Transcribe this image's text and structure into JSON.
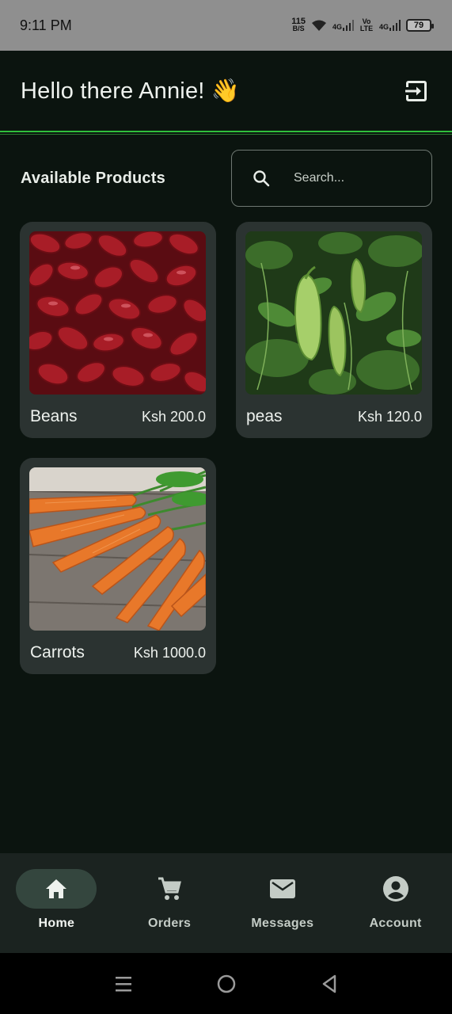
{
  "status": {
    "time": "9:11 PM",
    "speed_value": "115",
    "speed_unit": "B/S",
    "net1": "4G",
    "volte": "Vo LTE",
    "net2": "4G",
    "battery": "79"
  },
  "header": {
    "greeting": "Hello there Annie! 👋",
    "logout_icon": "logout-icon"
  },
  "products_section": {
    "title": "Available Products",
    "search_placeholder": "Search...",
    "search_value": ""
  },
  "products": [
    {
      "name": "Beans",
      "price": "Ksh 200.0",
      "image": "red-kidney-beans"
    },
    {
      "name": "peas",
      "price": "Ksh 120.0",
      "image": "pea-plant"
    },
    {
      "name": "Carrots",
      "price": "Ksh 1000.0",
      "image": "carrots"
    }
  ],
  "bottom_nav": {
    "items": [
      {
        "label": "Home",
        "icon": "home-icon",
        "active": true
      },
      {
        "label": "Orders",
        "icon": "cart-icon",
        "active": false
      },
      {
        "label": "Messages",
        "icon": "mail-icon",
        "active": false
      },
      {
        "label": "Account",
        "icon": "account-icon",
        "active": false
      }
    ]
  },
  "colors": {
    "background": "#0b140f",
    "accent_line": "#2fbf3c",
    "card": "#2b3331",
    "nav": "#1b2320",
    "active_pill": "#34463e"
  }
}
